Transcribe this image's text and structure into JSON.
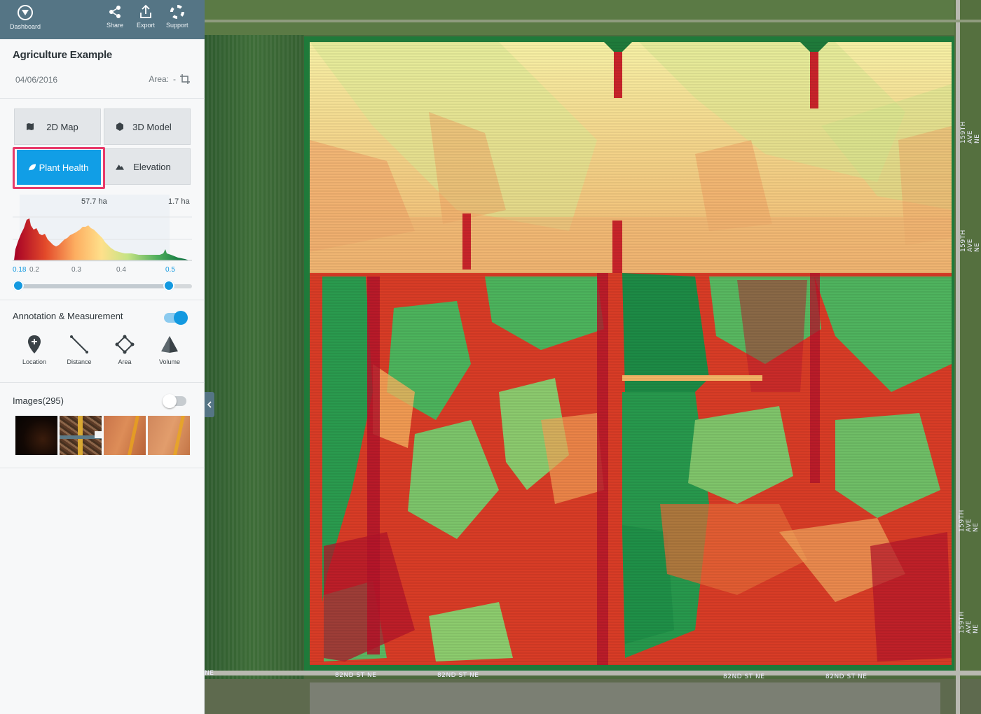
{
  "topbar": {
    "dashboard_label": "Dashboard",
    "share_label": "Share",
    "export_label": "Export",
    "support_label": "Support"
  },
  "project": {
    "name": "Agriculture Example",
    "date": "04/06/2016",
    "area_label": "Area:",
    "area_value": "-"
  },
  "modes": {
    "map2d": "2D Map",
    "model3d": "3D Model",
    "plant_health": "Plant Health",
    "elevation": "Elevation",
    "active": "Plant Health"
  },
  "histogram": {
    "left_area": "57.7 ha",
    "right_area": "1.7 ha",
    "min_value": "0.18",
    "ticks": [
      "0.2",
      "0.3",
      "0.4",
      "0.5"
    ],
    "range_low": 0.18,
    "range_high": 0.5
  },
  "annotation": {
    "title": "Annotation & Measurement",
    "enabled": true,
    "tools": [
      "Location",
      "Distance",
      "Area",
      "Volume"
    ]
  },
  "images": {
    "title": "Images(295)",
    "enabled": false
  },
  "map": {
    "road_labels": [
      "82ND ST NE",
      "82ND ST NE",
      "82ND ST NE",
      "82ND ST NE",
      "NE"
    ],
    "side_labels": [
      "159TH AVE NE",
      "159TH AVE NE",
      "159TH AVE NE",
      "159TH AVE NE"
    ]
  },
  "colors": {
    "header": "#557585",
    "accent": "#119ee6",
    "highlight": "#e83a6a"
  }
}
